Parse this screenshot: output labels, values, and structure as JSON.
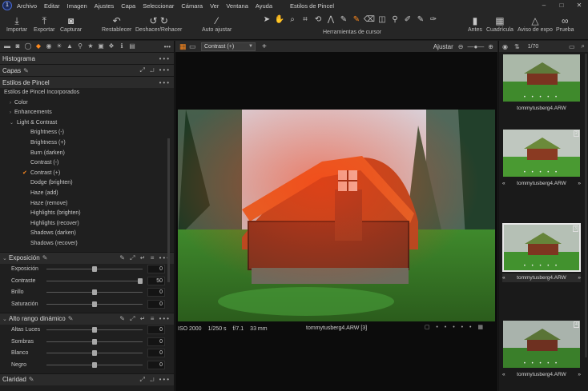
{
  "window": {
    "title": "Estilos de Pincel",
    "controls": [
      "–",
      "□",
      "✕"
    ]
  },
  "menu": [
    "Archivo",
    "Editar",
    "Imagen",
    "Ajustes",
    "Capa",
    "Seleccionar",
    "Cámara",
    "Ver",
    "Ventana",
    "Ayuda"
  ],
  "toolbar": {
    "import": "Importar",
    "export": "Exportar",
    "capture": "Capturar",
    "reset": "Restablecer",
    "undo_redo": "Deshacer/Rehacer",
    "auto_adjust": "Auto ajustar",
    "cursor_tools": "Herramientas de cursor",
    "before": "Antes",
    "grid": "Cuadrícula",
    "exposure_warning": "Aviso de expo",
    "proof": "Prueba"
  },
  "left_panel": {
    "histogram": "Histograma",
    "layers": "Capas",
    "brush_styles": {
      "title": "Estilos de Pincel",
      "group": "Estilos de Pincel Incorporados",
      "categories": [
        "Color",
        "Enhancements",
        "Light & Contrast"
      ],
      "items": [
        "Brightness (-)",
        "Brightness (+)",
        "Burn (darken)",
        "Contrast (-)",
        "Contrast (+)",
        "Dodge (brighten)",
        "Haze (add)",
        "Haze (remove)",
        "Highlights (brighten)",
        "Highlights (recover)",
        "Shadows (darken)",
        "Shadows (recover)"
      ],
      "selected_item": "Contrast (+)"
    },
    "exposure": {
      "title": "Exposición",
      "sliders": [
        {
          "label": "Exposición",
          "value": "0",
          "level": 0.5
        },
        {
          "label": "Contraste",
          "value": "50",
          "level": 1.0
        },
        {
          "label": "Brillo",
          "value": "0",
          "level": 0.5
        },
        {
          "label": "Saturación",
          "value": "0",
          "level": 0.5
        }
      ]
    },
    "hdr": {
      "title": "Alto rango dinámico",
      "sliders": [
        {
          "label": "Altas Luces",
          "value": "0",
          "level": 0.5
        },
        {
          "label": "Sombras",
          "value": "0",
          "level": 0.5
        },
        {
          "label": "Blanco",
          "value": "0",
          "level": 0.5
        },
        {
          "label": "Negro",
          "value": "0",
          "level": 0.5
        }
      ]
    },
    "clarity": "Claridad"
  },
  "viewer": {
    "layer": "Contrast (+)",
    "fit": "Ajustar",
    "footer": {
      "iso": "ISO 2000",
      "shutter": "1/250 s",
      "aperture": "f/7.1",
      "focal": "33 mm",
      "filename": "tommytusberg4.ARW [3]"
    }
  },
  "browser": {
    "count": "1/70",
    "thumbnails": [
      {
        "name": "tommytusberg4.ARW",
        "badge": "",
        "selected": false
      },
      {
        "name": "tommytusberg4.ARW",
        "badge": "2",
        "selected": false
      },
      {
        "name": "tommytusberg4.ARW",
        "badge": "3",
        "selected": true
      },
      {
        "name": "tommytusberg4.ARW",
        "badge": "4",
        "selected": false
      }
    ]
  }
}
